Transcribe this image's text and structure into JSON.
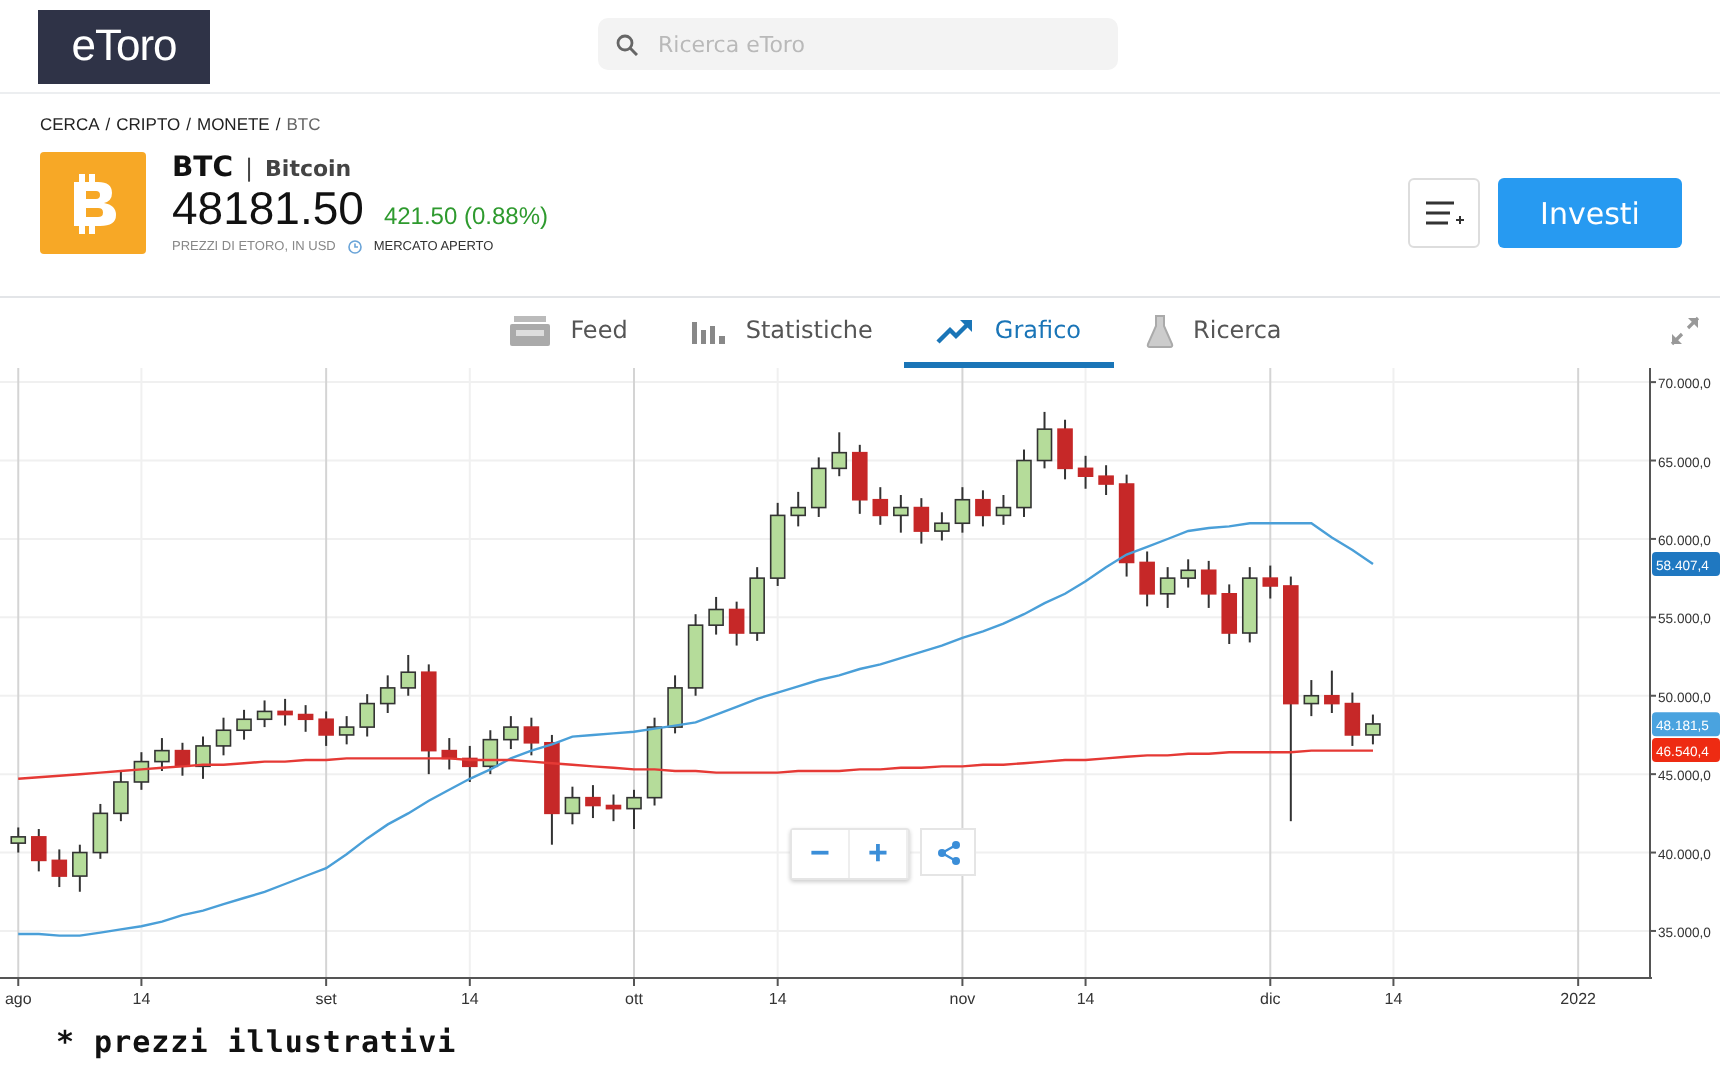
{
  "header": {
    "logo": "eToro",
    "search": {
      "placeholder": "Ricerca eToro"
    }
  },
  "breadcrumb": {
    "items": [
      "CERCA",
      "CRIPTO",
      "MONETE",
      "BTC"
    ],
    "separator": "/"
  },
  "instrument": {
    "symbol": "BTC",
    "separator": "|",
    "name": "Bitcoin",
    "price": "48181.50",
    "change": "421.50 (0.88%)",
    "source": "PREZZI DI ETORO, IN USD",
    "market_status": "MERCATO APERTO"
  },
  "actions": {
    "invest": "Investi"
  },
  "tabs": [
    {
      "label": "Feed",
      "kind": "feed",
      "selected": false
    },
    {
      "label": "Statistiche",
      "kind": "stats",
      "selected": false
    },
    {
      "label": "Grafico",
      "kind": "chart",
      "selected": true
    },
    {
      "label": "Ricerca",
      "kind": "research",
      "selected": false
    }
  ],
  "chart": {
    "chart_data": {
      "type": "candlestick",
      "grid": true,
      "categories": [
        "ago",
        null,
        null,
        null,
        null,
        null,
        "14",
        null,
        null,
        null,
        null,
        null,
        null,
        null,
        null,
        "set",
        null,
        null,
        null,
        null,
        null,
        null,
        "14",
        null,
        null,
        null,
        null,
        null,
        null,
        null,
        "ott",
        null,
        null,
        null,
        null,
        null,
        null,
        "14",
        null,
        null,
        null,
        null,
        null,
        null,
        null,
        null,
        "nov",
        null,
        null,
        null,
        null,
        null,
        "14",
        null,
        null,
        null,
        null,
        null,
        null,
        null,
        null,
        "dic",
        null,
        null,
        null,
        null,
        null,
        "14",
        null,
        null,
        null,
        null,
        null,
        null,
        null,
        null,
        "2022",
        null,
        null,
        null
      ],
      "ohlc": [
        [
          40600,
          41600,
          40000,
          41000
        ],
        [
          41000,
          41500,
          38800,
          39500
        ],
        [
          39500,
          40200,
          37800,
          38500
        ],
        [
          38500,
          40500,
          37500,
          40000
        ],
        [
          40000,
          43100,
          39600,
          42500
        ],
        [
          42500,
          45200,
          42000,
          44500
        ],
        [
          44500,
          46400,
          44000,
          45800
        ],
        [
          45800,
          47300,
          45200,
          46500
        ],
        [
          46500,
          47000,
          44900,
          45500
        ],
        [
          45500,
          47400,
          44700,
          46800
        ],
        [
          46800,
          48600,
          46200,
          47800
        ],
        [
          47800,
          49100,
          47200,
          48500
        ],
        [
          48500,
          49700,
          48000,
          49000
        ],
        [
          49000,
          49800,
          48100,
          48800
        ],
        [
          48800,
          49400,
          47700,
          48500
        ],
        [
          48500,
          49000,
          46800,
          47500
        ],
        [
          47500,
          48700,
          46900,
          48000
        ],
        [
          48000,
          50100,
          47400,
          49500
        ],
        [
          49500,
          51300,
          48900,
          50500
        ],
        [
          50500,
          52600,
          50000,
          51500
        ],
        [
          51500,
          52000,
          45000,
          46500
        ],
        [
          46500,
          47300,
          45300,
          46000
        ],
        [
          46000,
          46800,
          44500,
          45500
        ],
        [
          45500,
          47800,
          45000,
          47200
        ],
        [
          47200,
          48700,
          46600,
          48000
        ],
        [
          48000,
          48600,
          46200,
          47000
        ],
        [
          47000,
          47500,
          40500,
          42500
        ],
        [
          42500,
          44200,
          41800,
          43500
        ],
        [
          43500,
          44300,
          42200,
          43000
        ],
        [
          43000,
          43700,
          42000,
          42800
        ],
        [
          42800,
          44000,
          41500,
          43500
        ],
        [
          43500,
          48600,
          43000,
          48000
        ],
        [
          48000,
          51300,
          47600,
          50500
        ],
        [
          50500,
          55200,
          50000,
          54500
        ],
        [
          54500,
          56300,
          53900,
          55500
        ],
        [
          55500,
          56000,
          53200,
          54000
        ],
        [
          54000,
          58200,
          53500,
          57500
        ],
        [
          57500,
          62300,
          57000,
          61500
        ],
        [
          61500,
          63000,
          60800,
          62000
        ],
        [
          62000,
          65200,
          61400,
          64500
        ],
        [
          64500,
          66800,
          64000,
          65500
        ],
        [
          65500,
          66000,
          61600,
          62500
        ],
        [
          62500,
          63300,
          60900,
          61500
        ],
        [
          61500,
          62800,
          60400,
          62000
        ],
        [
          62000,
          62600,
          59700,
          60500
        ],
        [
          60500,
          61700,
          59900,
          61000
        ],
        [
          61000,
          63300,
          60400,
          62500
        ],
        [
          62500,
          63100,
          60800,
          61500
        ],
        [
          61500,
          62800,
          60900,
          62000
        ],
        [
          62000,
          65700,
          61400,
          65000
        ],
        [
          65000,
          68100,
          64500,
          67000
        ],
        [
          67000,
          67600,
          63800,
          64500
        ],
        [
          64500,
          65300,
          63200,
          64000
        ],
        [
          64000,
          64700,
          62800,
          63500
        ],
        [
          63500,
          64100,
          57600,
          58500
        ],
        [
          58500,
          59200,
          55700,
          56500
        ],
        [
          56500,
          58200,
          55600,
          57500
        ],
        [
          57500,
          58700,
          56900,
          58000
        ],
        [
          58000,
          58600,
          55600,
          56500
        ],
        [
          56500,
          57100,
          53300,
          54000
        ],
        [
          54000,
          58200,
          53400,
          57500
        ],
        [
          57500,
          58300,
          56200,
          57000
        ],
        [
          57000,
          57600,
          42000,
          49500
        ],
        [
          49500,
          51000,
          48700,
          50000
        ],
        [
          50000,
          51600,
          48900,
          49500
        ],
        [
          49500,
          50200,
          46800,
          47500
        ],
        [
          47500,
          48800,
          46900,
          48200
        ],
        null,
        null,
        null,
        null,
        null,
        null,
        null,
        null,
        null,
        null,
        null,
        null,
        null
      ],
      "series": [
        {
          "type": "line",
          "color": "#4a9fd8",
          "values": [
            34800,
            34800,
            34700,
            34700,
            34900,
            35100,
            35300,
            35600,
            36000,
            36300,
            36700,
            37100,
            37500,
            38000,
            38500,
            39000,
            39900,
            40900,
            41800,
            42500,
            43300,
            44000,
            44700,
            45300,
            46000,
            46500,
            46900,
            47400,
            47500,
            47600,
            47700,
            47900,
            48100,
            48300,
            48800,
            49300,
            49800,
            50200,
            50600,
            51000,
            51300,
            51700,
            52000,
            52400,
            52800,
            53200,
            53700,
            54100,
            54600,
            55200,
            55900,
            56500,
            57300,
            58200,
            59000,
            59500,
            60000,
            60500,
            60700,
            60800,
            61000,
            61000,
            61000,
            61000,
            60100,
            59300,
            58400,
            null,
            null,
            null,
            null,
            null,
            null,
            null,
            null,
            null,
            null,
            null,
            null,
            null
          ]
        },
        {
          "type": "line",
          "color": "#e53935",
          "values": [
            44700,
            44800,
            44900,
            45000,
            45100,
            45200,
            45300,
            45400,
            45500,
            45600,
            45600,
            45700,
            45800,
            45800,
            45900,
            45900,
            46000,
            46000,
            46000,
            46000,
            46000,
            46000,
            45900,
            45900,
            45900,
            45800,
            45700,
            45600,
            45500,
            45400,
            45300,
            45300,
            45200,
            45200,
            45100,
            45100,
            45100,
            45100,
            45200,
            45200,
            45200,
            45300,
            45300,
            45400,
            45400,
            45500,
            45500,
            45600,
            45600,
            45700,
            45800,
            45900,
            45900,
            46000,
            46100,
            46200,
            46200,
            46300,
            46300,
            46400,
            46400,
            46400,
            46400,
            46500,
            46500,
            46500,
            46500,
            null,
            null,
            null,
            null,
            null,
            null,
            null,
            null,
            null,
            null,
            null,
            null,
            null
          ]
        }
      ],
      "ylim": [
        32000,
        70900
      ],
      "yticks": [
        {
          "value": 35000,
          "label": "35.000,0"
        },
        {
          "value": 40000,
          "label": "40.000,0"
        },
        {
          "value": 45000,
          "label": "45.000,0"
        },
        {
          "value": 50000,
          "label": "50.000,0"
        },
        {
          "value": 55000,
          "label": "55.000,0"
        },
        {
          "value": 60000,
          "label": "60.000,0"
        },
        {
          "value": 65000,
          "label": "65.000,0"
        },
        {
          "value": 70000,
          "label": "70.000,0"
        }
      ]
    },
    "price_tags": [
      {
        "label": "58.407,4",
        "color": "#1f78c1"
      },
      {
        "label": "48.181,5",
        "color": "#4aa3df"
      },
      {
        "label": "46.540,4",
        "color": "#ee2b12"
      }
    ],
    "zoom_controls": [
      "−",
      "+"
    ]
  },
  "footnote": "* prezzi illustrativi"
}
